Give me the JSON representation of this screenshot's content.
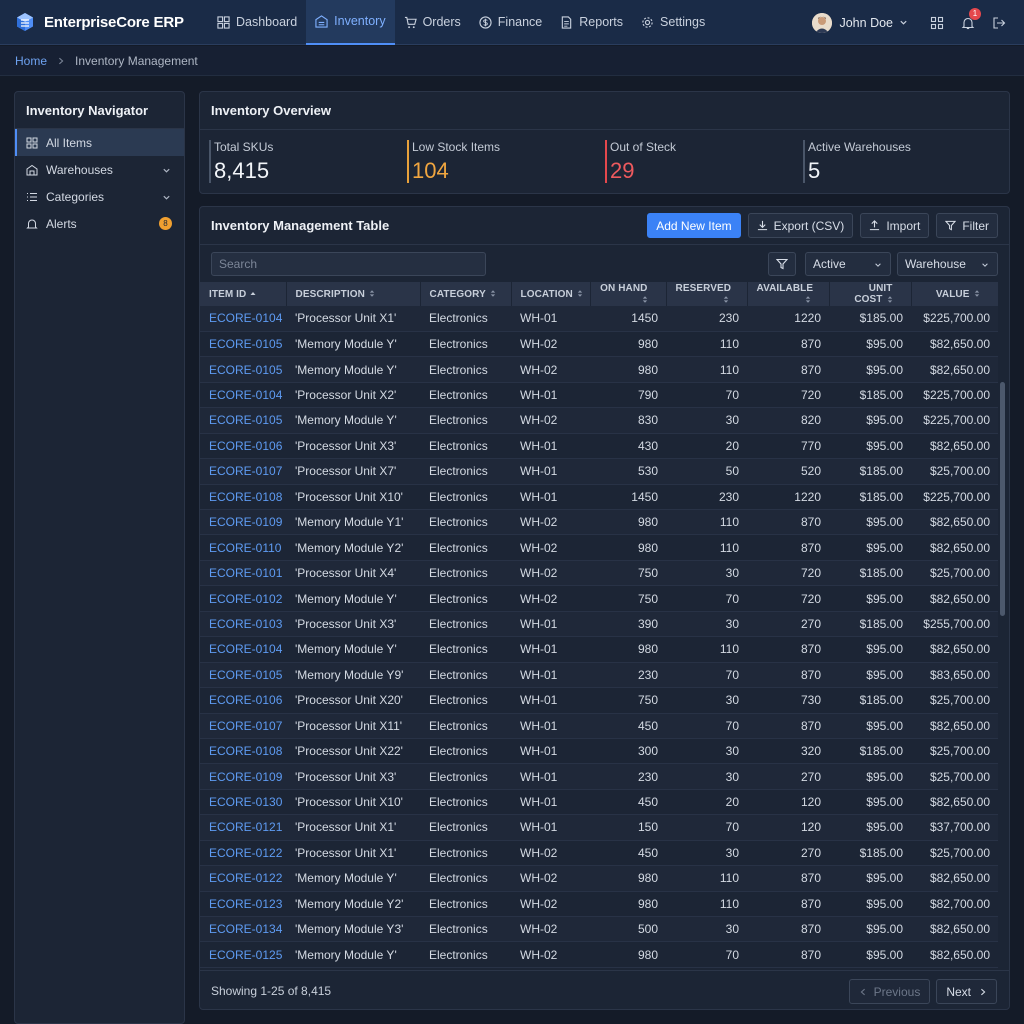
{
  "app": {
    "name": "EnterpriseCore ERP"
  },
  "nav": [
    {
      "label": "Dashboard",
      "icon": "dashboard-icon"
    },
    {
      "label": "Inventory",
      "icon": "box-icon",
      "active": true
    },
    {
      "label": "Orders",
      "icon": "cart-icon"
    },
    {
      "label": "Finance",
      "icon": "dollar-icon"
    },
    {
      "label": "Reports",
      "icon": "report-icon"
    },
    {
      "label": "Settings",
      "icon": "gear-icon"
    }
  ],
  "user": {
    "name": "John Doe",
    "notifications": "1"
  },
  "breadcrumb": {
    "home": "Home",
    "current": "Inventory Management"
  },
  "sidebar": {
    "title": "Inventory Navigator",
    "items": [
      {
        "label": "All Items",
        "icon": "grid-icon"
      },
      {
        "label": "Warehouses",
        "icon": "warehouse-icon"
      },
      {
        "label": "Categories",
        "icon": "list-icon"
      },
      {
        "label": "Alerts",
        "icon": "bell-icon",
        "badge": "8"
      }
    ]
  },
  "overview": {
    "title": "Inventory Overview",
    "stats": [
      {
        "label": "Total SKUs",
        "value": "8,415"
      },
      {
        "label": "Low Stock Items",
        "value": "104"
      },
      {
        "label": "Out of Steck",
        "value": "29"
      },
      {
        "label": "Active Warehouses",
        "value": "5"
      }
    ]
  },
  "table": {
    "title": "Inventory Management Table",
    "actions": {
      "add": "Add New Item",
      "export": "Export (CSV)",
      "import": "Import",
      "filter": "Filter"
    },
    "search_placeholder": "Search",
    "status_select": "Active",
    "warehouse_select": "Warehouse",
    "columns": [
      "ITEM ID",
      "DESCRIPTION",
      "CATEGORY",
      "LOCATION",
      "ON HAND",
      "RESERVED",
      "AVAILABLE",
      "UNIT COST",
      "VALUE"
    ],
    "rows": [
      [
        "ECORE-0104",
        "'Processor Unit X1'",
        "Electronics",
        "WH-01",
        "1450",
        "230",
        "1220",
        "$185.00",
        "$225,700.00"
      ],
      [
        "ECORE-0105",
        "'Memory Module Y'",
        "Electronics",
        "WH-02",
        "980",
        "110",
        "870",
        "$95.00",
        "$82,650.00"
      ],
      [
        "ECORE-0105",
        "'Memory Module Y'",
        "Electronics",
        "WH-02",
        "980",
        "110",
        "870",
        "$95.00",
        "$82,650.00"
      ],
      [
        "ECORE-0104",
        "'Processor Unit X2'",
        "Electronics",
        "WH-01",
        "790",
        "70",
        "720",
        "$185.00",
        "$225,700.00"
      ],
      [
        "ECORE-0105",
        "'Memory Module Y'",
        "Electronics",
        "WH-02",
        "830",
        "30",
        "820",
        "$95.00",
        "$225,700.00"
      ],
      [
        "ECORE-0106",
        "'Processor Unit X3'",
        "Electronics",
        "WH-01",
        "430",
        "20",
        "770",
        "$95.00",
        "$82,650.00"
      ],
      [
        "ECORE-0107",
        "'Processor Unit X7'",
        "Electronics",
        "WH-01",
        "530",
        "50",
        "520",
        "$185.00",
        "$25,700.00"
      ],
      [
        "ECORE-0108",
        "'Processor Unit X10'",
        "Electronics",
        "WH-01",
        "1450",
        "230",
        "1220",
        "$185.00",
        "$225,700.00"
      ],
      [
        "ECORE-0109",
        "'Memory Module Y1'",
        "Electronics",
        "WH-02",
        "980",
        "110",
        "870",
        "$95.00",
        "$82,650.00"
      ],
      [
        "ECORE-0110",
        "'Memory Module Y2'",
        "Electronics",
        "WH-02",
        "980",
        "110",
        "870",
        "$95.00",
        "$82,650.00"
      ],
      [
        "ECORE-0101",
        "'Processor Unit X4'",
        "Electronics",
        "WH-02",
        "750",
        "30",
        "720",
        "$185.00",
        "$25,700.00"
      ],
      [
        "ECORE-0102",
        "'Memory Module Y'",
        "Electronics",
        "WH-02",
        "750",
        "70",
        "720",
        "$95.00",
        "$82,650.00"
      ],
      [
        "ECORE-0103",
        "'Processor Unit X3'",
        "Electronics",
        "WH-01",
        "390",
        "30",
        "270",
        "$185.00",
        "$255,700.00"
      ],
      [
        "ECORE-0104",
        "'Memory Module Y'",
        "Electronics",
        "WH-01",
        "980",
        "110",
        "870",
        "$95.00",
        "$82,650.00"
      ],
      [
        "ECORE-0105",
        "'Memory Module Y9'",
        "Electronics",
        "WH-01",
        "230",
        "70",
        "870",
        "$95.00",
        "$83,650.00"
      ],
      [
        "ECORE-0106",
        "'Processor Unit X20'",
        "Electronics",
        "WH-01",
        "750",
        "30",
        "730",
        "$185.00",
        "$25,700.00"
      ],
      [
        "ECORE-0107",
        "'Processor Unit X11'",
        "Electronics",
        "WH-01",
        "450",
        "70",
        "870",
        "$95.00",
        "$82,650.00"
      ],
      [
        "ECORE-0108",
        "'Processor Unit X22'",
        "Electronics",
        "WH-01",
        "300",
        "30",
        "320",
        "$185.00",
        "$25,700.00"
      ],
      [
        "ECORE-0109",
        "'Processor Unit X3'",
        "Electronics",
        "WH-01",
        "230",
        "30",
        "270",
        "$95.00",
        "$25,700.00"
      ],
      [
        "ECORE-0130",
        "'Processor Unit X10'",
        "Electronics",
        "WH-01",
        "450",
        "20",
        "120",
        "$95.00",
        "$82,650.00"
      ],
      [
        "ECORE-0121",
        "'Processor Unit X1'",
        "Electronics",
        "WH-01",
        "150",
        "70",
        "120",
        "$95.00",
        "$37,700.00"
      ],
      [
        "ECORE-0122",
        "'Processor Unit X1'",
        "Electronics",
        "WH-02",
        "450",
        "30",
        "270",
        "$185.00",
        "$25,700.00"
      ],
      [
        "ECORE-0122",
        "'Memory Module Y'",
        "Electronics",
        "WH-02",
        "980",
        "110",
        "870",
        "$95.00",
        "$82,650.00"
      ],
      [
        "ECORE-0123",
        "'Memory Module Y2'",
        "Electronics",
        "WH-02",
        "980",
        "110",
        "870",
        "$95.00",
        "$82,700.00"
      ],
      [
        "ECORE-0134",
        "'Memory Module Y3'",
        "Electronics",
        "WH-02",
        "500",
        "30",
        "870",
        "$95.00",
        "$82,650.00"
      ],
      [
        "ECORE-0125",
        "'Memory Module Y'",
        "Electronics",
        "WH-02",
        "980",
        "70",
        "870",
        "$95.00",
        "$82,650.00"
      ]
    ],
    "footer": {
      "showing": "Showing 1-25 of 8,415",
      "previous": "Previous",
      "next": "Next"
    }
  },
  "colors": {
    "accent": "#3b82f6",
    "warning": "#f0a640",
    "danger": "#ee5a5e",
    "topbar": "#1a2b47"
  }
}
